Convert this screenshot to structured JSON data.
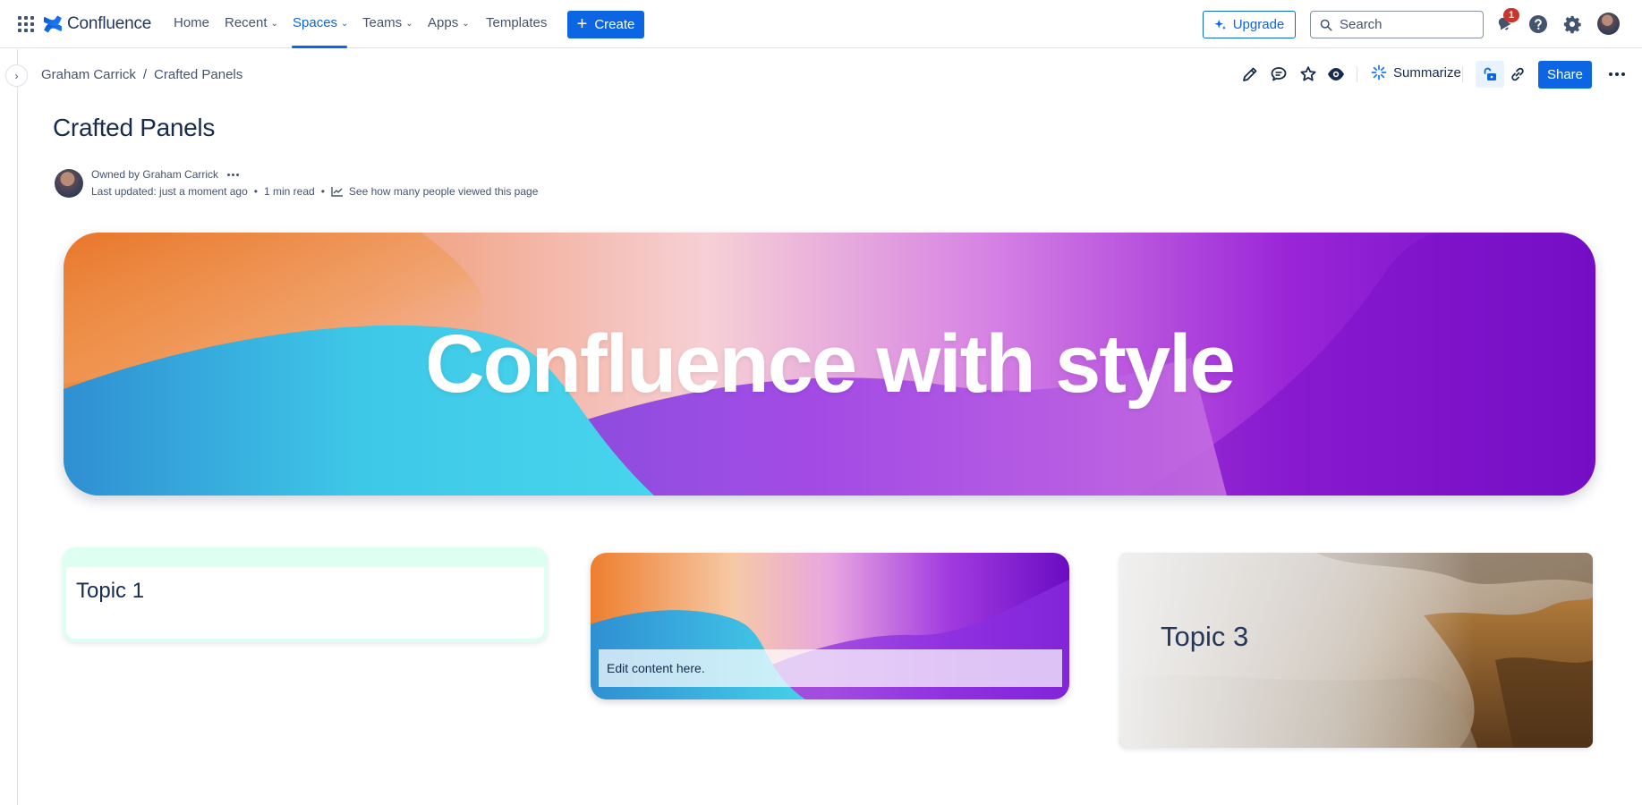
{
  "app": {
    "name": "Confluence"
  },
  "nav": {
    "home": "Home",
    "recent": "Recent",
    "spaces": "Spaces",
    "teams": "Teams",
    "apps": "Apps",
    "templates": "Templates",
    "create": "Create",
    "upgrade": "Upgrade",
    "search_placeholder": "Search",
    "notification_count": "1",
    "active_item": "Spaces"
  },
  "breadcrumb": [
    "Graham Carrick",
    "Crafted Panels"
  ],
  "toolbar": {
    "summarize": "Summarize",
    "share": "Share",
    "icons": [
      "edit-icon",
      "comment-icon",
      "star-icon",
      "watch-icon",
      "restrictions-icon",
      "copy-link-icon",
      "more-icon"
    ]
  },
  "page": {
    "title": "Crafted Panels",
    "owned_by": "Owned by Graham Carrick",
    "last_updated": "Last updated: just a moment ago",
    "read_time": "1 min read",
    "analytics_link": "See how many people viewed this page"
  },
  "hero": {
    "title": "Confluence with style"
  },
  "panels": [
    {
      "heading": "Topic 1",
      "accent": "#dcfff1"
    },
    {
      "text": "Edit content here."
    },
    {
      "heading": "Topic 3"
    }
  ],
  "colors": {
    "brand_blue": "#0c66e4",
    "text": "#172b4d",
    "subtle_text": "#44546f",
    "badge_red": "#c9372c"
  }
}
